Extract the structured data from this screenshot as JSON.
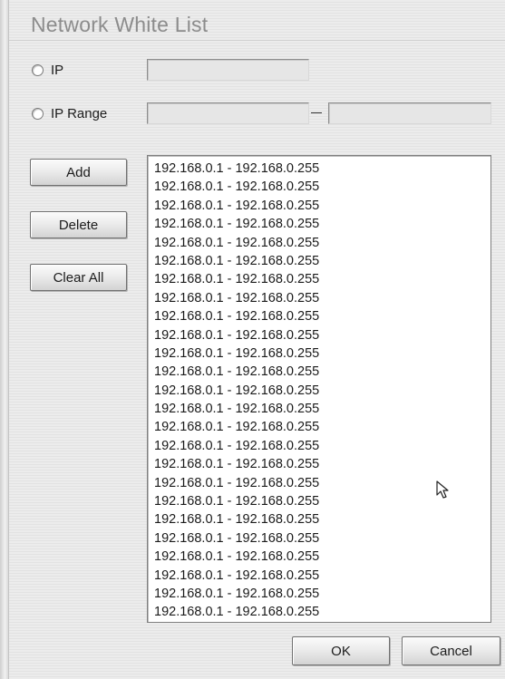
{
  "dialog": {
    "title": "Network White List"
  },
  "options": {
    "ip_label": "IP",
    "ip_range_label": "IP Range",
    "ip_value": "",
    "range_start_value": "",
    "range_end_value": "",
    "range_separator": "–"
  },
  "buttons": {
    "add_label": "Add",
    "delete_label": "Delete",
    "clear_all_label": "Clear All",
    "ok_label": "OK",
    "cancel_label": "Cancel"
  },
  "white_list": {
    "entries": [
      "192.168.0.1 - 192.168.0.255",
      "192.168.0.1 - 192.168.0.255",
      "192.168.0.1 - 192.168.0.255",
      "192.168.0.1 - 192.168.0.255",
      "192.168.0.1 - 192.168.0.255",
      "192.168.0.1 - 192.168.0.255",
      "192.168.0.1 - 192.168.0.255",
      "192.168.0.1 - 192.168.0.255",
      "192.168.0.1 - 192.168.0.255",
      "192.168.0.1 - 192.168.0.255",
      "192.168.0.1 - 192.168.0.255",
      "192.168.0.1 - 192.168.0.255",
      "192.168.0.1 - 192.168.0.255",
      "192.168.0.1 - 192.168.0.255",
      "192.168.0.1 - 192.168.0.255",
      "192.168.0.1 - 192.168.0.255",
      "192.168.0.1 - 192.168.0.255",
      "192.168.0.1 - 192.168.0.255",
      "192.168.0.1 - 192.168.0.255",
      "192.168.0.1 - 192.168.0.255",
      "192.168.0.1 - 192.168.0.255",
      "192.168.0.1 - 192.168.0.255",
      "192.168.0.1 - 192.168.0.255",
      "192.168.0.1 - 192.168.0.255",
      "192.168.0.1 - 192.168.0.255"
    ]
  },
  "icons": {
    "cursor": "mouse-pointer-icon"
  },
  "colors": {
    "title_text": "#8c8c8c",
    "window_background": "#e9e9e9",
    "field_background": "#e6e6e6",
    "list_background": "#ffffff"
  }
}
